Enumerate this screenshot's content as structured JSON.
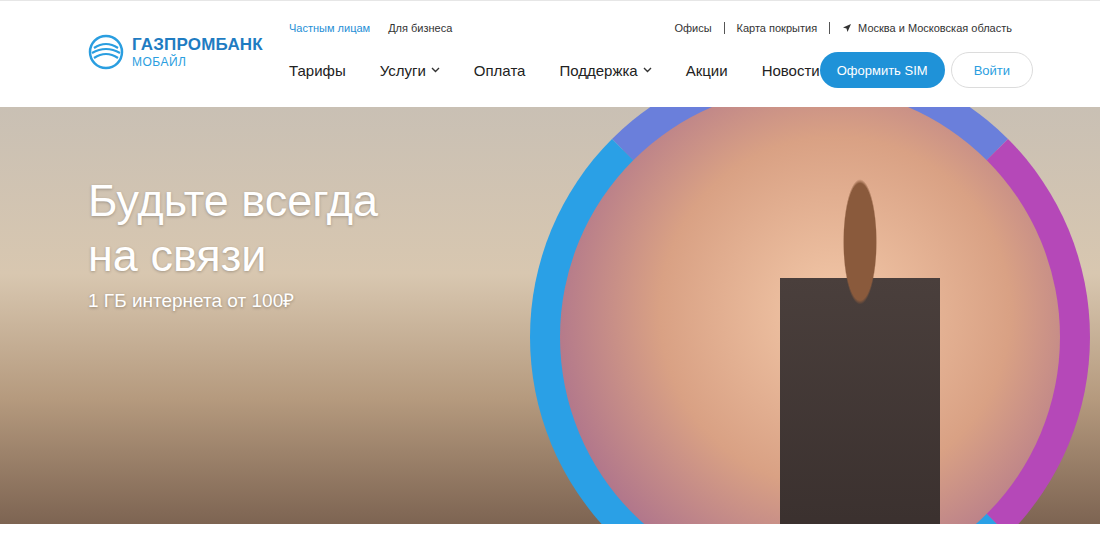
{
  "logo": {
    "name": "ГАЗПРОМБАНК",
    "sub": "МОБАЙЛ"
  },
  "segments": [
    {
      "label": "Частным лицам",
      "selected": true
    },
    {
      "label": "Для бизнеса",
      "selected": false
    }
  ],
  "top_links": [
    "Офисы",
    "Карта покрытия"
  ],
  "region": "Москва и Московская область",
  "nav": [
    {
      "label": "Тарифы",
      "dropdown": false
    },
    {
      "label": "Услуги",
      "dropdown": true
    },
    {
      "label": "Оплата",
      "dropdown": false
    },
    {
      "label": "Поддержка",
      "dropdown": true
    },
    {
      "label": "Акции",
      "dropdown": false
    },
    {
      "label": "Новости",
      "dropdown": false
    }
  ],
  "buttons": {
    "primary": "Оформить SIM",
    "login": "Войти"
  },
  "hero": {
    "title_lines": [
      "Будьте всегда",
      "на связи"
    ],
    "subtitle": "1 ГБ интернета от 100₽"
  }
}
